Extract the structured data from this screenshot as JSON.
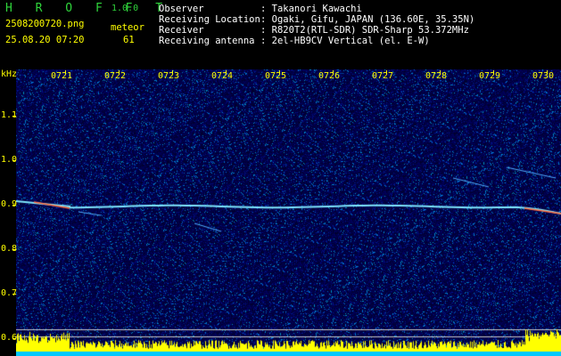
{
  "header": {
    "brand": "H R O F F T",
    "version": "1.0.0",
    "filename": "2508200720.png",
    "datetime": "25.08.20 07:20",
    "meteor_label": "meteor",
    "meteor_count": "61",
    "info": [
      {
        "key": "Observer",
        "value": ": Takanori Kawachi"
      },
      {
        "key": "Receiving Location",
        "value": ": Ogaki, Gifu, JAPAN (136.60E, 35.35N)"
      },
      {
        "key": "Receiver",
        "value": ": R820T2(RTL-SDR) SDR-Sharp 53.372MHz"
      },
      {
        "key": "Receiving antenna",
        "value": ": 2el-HB9CV Vertical (el. E-W)"
      }
    ]
  },
  "axes": {
    "y_unit": "kHz",
    "y_ticks": [
      "1.1",
      "1.0",
      "0.9",
      "0.8",
      "0.7",
      "0.6"
    ],
    "x_ticks": [
      "0721",
      "0722",
      "0723",
      "0724",
      "0725",
      "0726",
      "0727",
      "0728",
      "0729",
      "0730"
    ]
  },
  "colors": {
    "background": "#000000",
    "spectrogram_bg": "#0a0a5a",
    "trace": "#7fe8ff",
    "label": "#ffff00",
    "brand": "#2fd43b",
    "amplitude_fill": "#ffff00",
    "amplitude_base": "#00c8ff"
  }
}
